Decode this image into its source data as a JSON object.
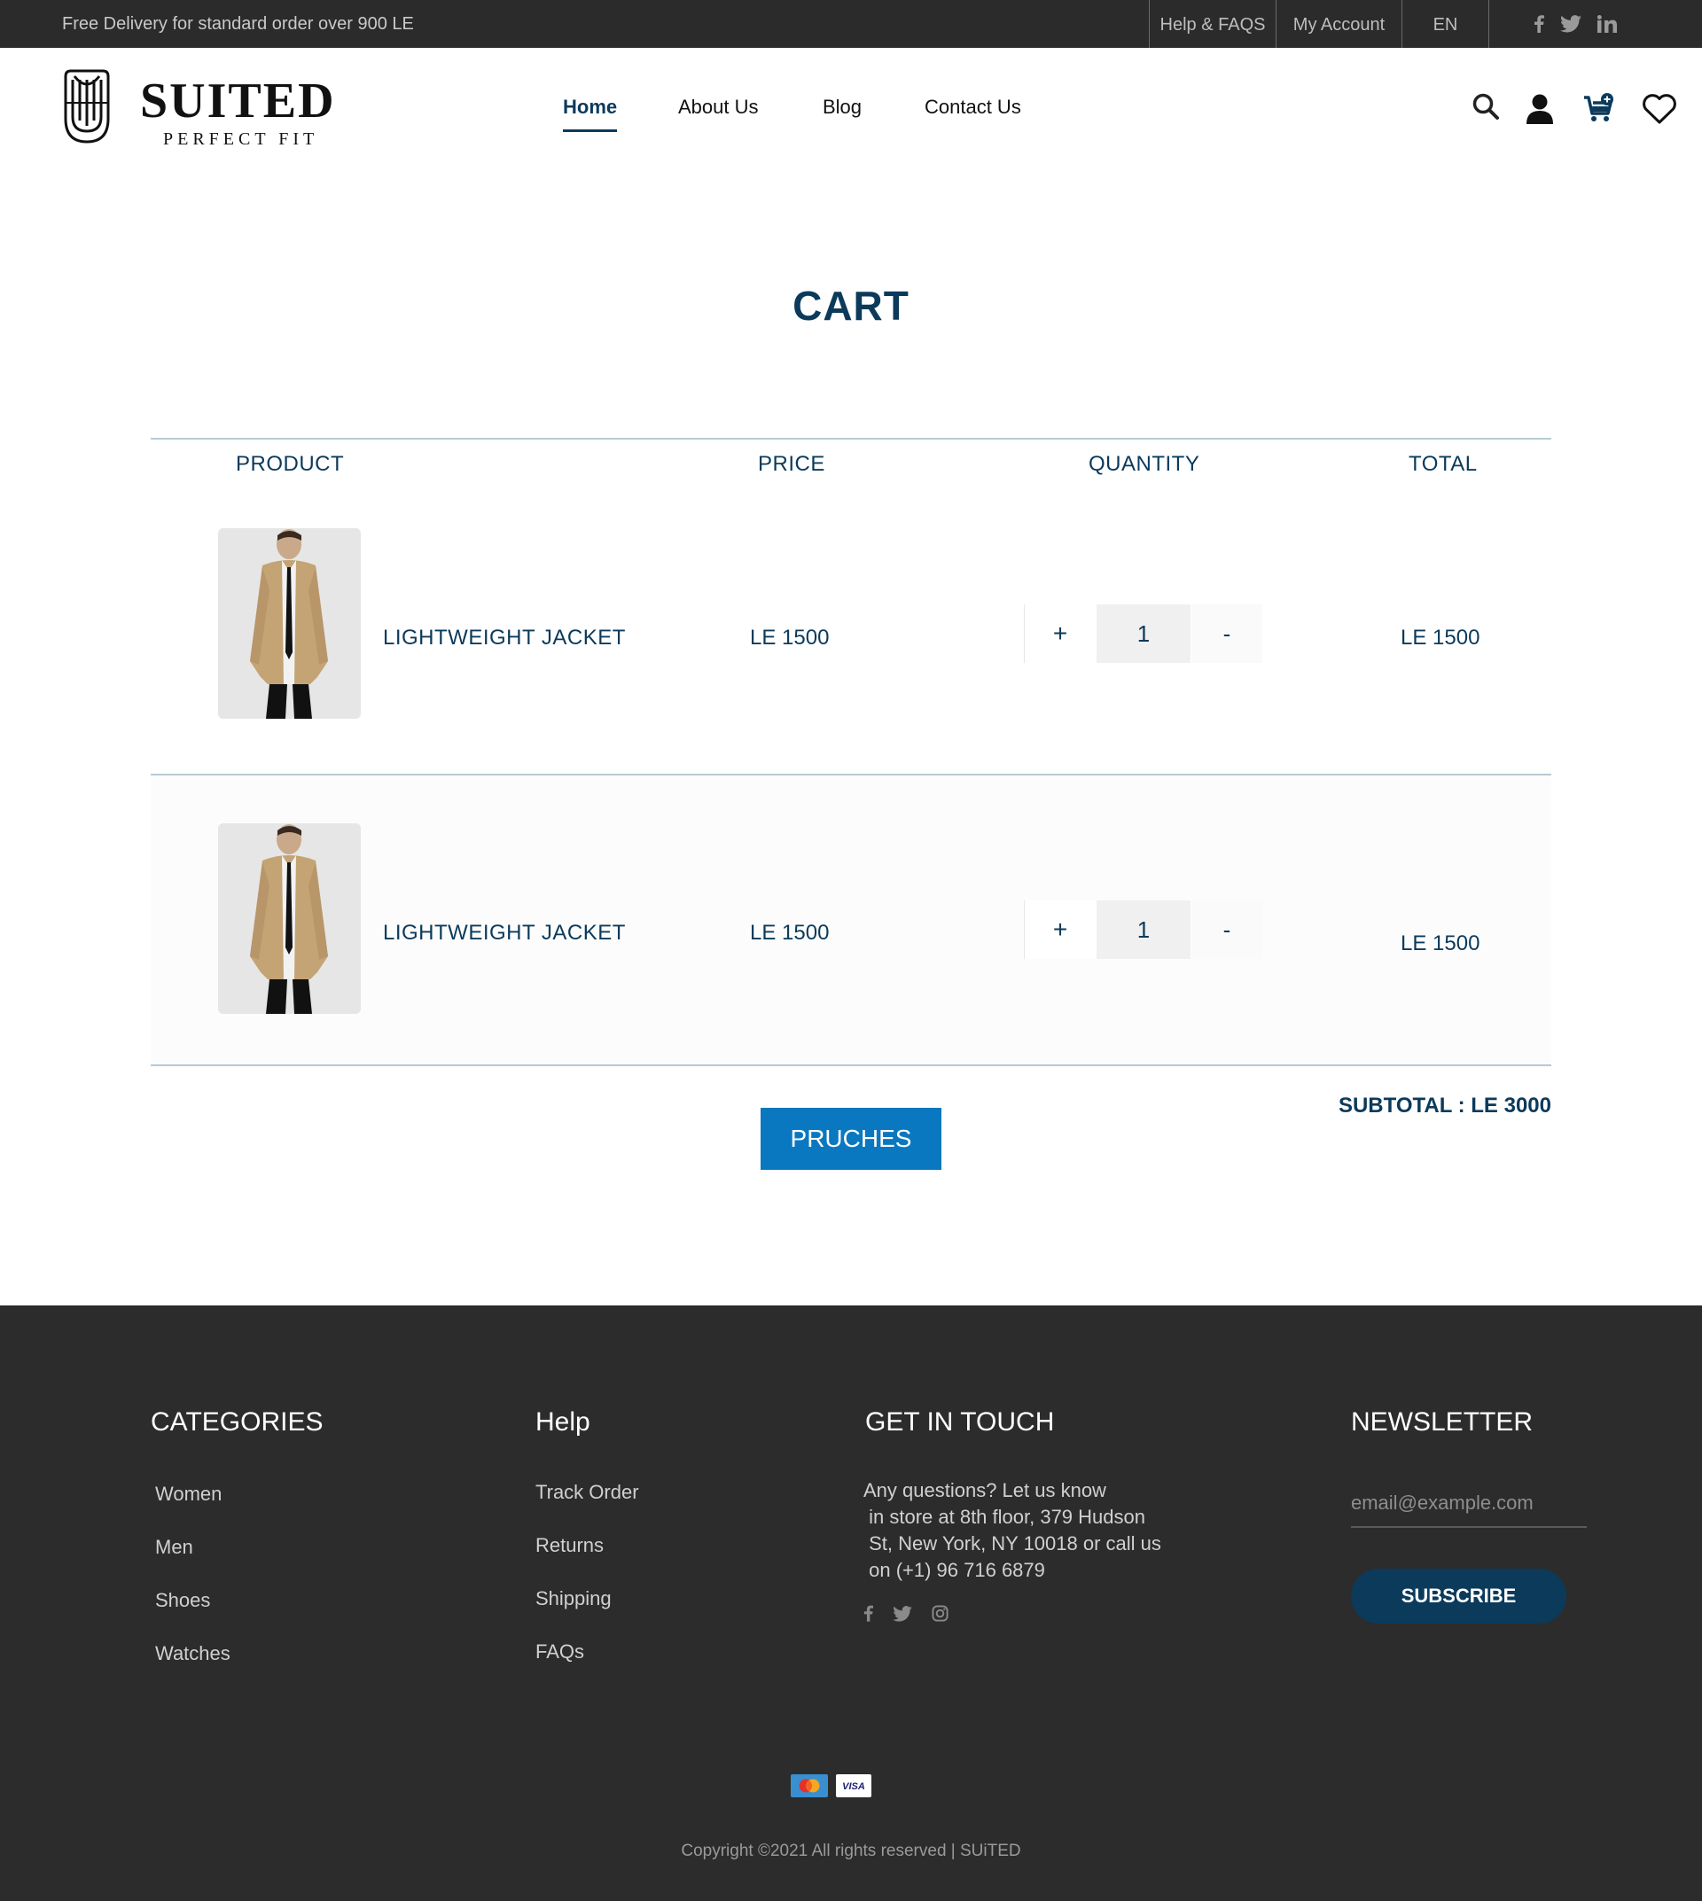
{
  "topbar": {
    "promo": "Free Delivery for standard order over 900 LE",
    "links": {
      "help": "Help & FAQS",
      "account": "My Account",
      "language": "EN"
    },
    "social_icons": [
      "facebook-icon",
      "twitter-icon",
      "linkedin-icon"
    ]
  },
  "brand": {
    "name": "SUITED",
    "tagline": "PERFECT FIT"
  },
  "nav": {
    "items": [
      "Home",
      "About Us",
      "Blog",
      "Contact Us"
    ],
    "active": "Home"
  },
  "header_icons": [
    "search-icon",
    "user-icon",
    "cart-icon",
    "heart-icon"
  ],
  "cart": {
    "title": "CART",
    "columns": {
      "product": "PRODUCT",
      "price": "PRICE",
      "quantity": "QUANTITY",
      "total": "TOTAL"
    },
    "items": [
      {
        "name": "LIGHTWEIGHT JACKET",
        "price": "LE 1500",
        "quantity": "1",
        "total": "LE 1500",
        "plus": "+",
        "minus": "-"
      },
      {
        "name": "LIGHTWEIGHT JACKET",
        "price": "LE 1500",
        "quantity": "1",
        "total": "LE 1500",
        "plus": "+",
        "minus": "-"
      }
    ],
    "subtotal": "SUBTOTAL : LE 3000",
    "purchase_button": "PRUCHES"
  },
  "footer": {
    "categories": {
      "title": "CATEGORIES",
      "items": [
        "Women",
        "Men",
        "Shoes",
        "Watches"
      ]
    },
    "help": {
      "title": "Help",
      "items": [
        "Track Order",
        "Returns",
        "Shipping",
        "FAQs"
      ]
    },
    "contact": {
      "title": "GET IN TOUCH",
      "lines": [
        "Any questions? Let us know",
        " in store at 8th floor, 379 Hudson",
        " St, New York, NY 10018 or call us",
        " on (+1) 96 716 6879"
      ],
      "social_icons": [
        "facebook-icon",
        "twitter-icon",
        "instagram-icon"
      ]
    },
    "newsletter": {
      "title": "NEWSLETTER",
      "placeholder": "email@example.com",
      "button": "SUBSCRIBE"
    },
    "payment_icons": [
      "mastercard-icon",
      "visa-icon"
    ],
    "copyright": "Copyright ©2021 All rights reserved | SUiTED"
  },
  "colors": {
    "navy": "#0b3a5b",
    "button_blue": "#0a78c0",
    "topbar": "#2b2b2b",
    "footer": "#2c2c2c"
  }
}
